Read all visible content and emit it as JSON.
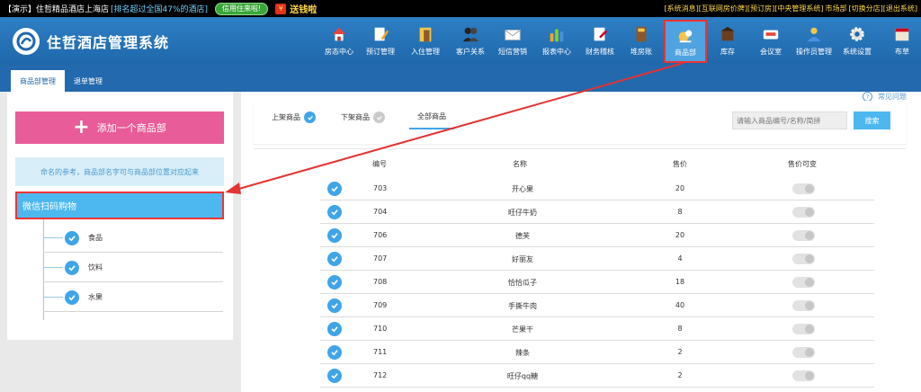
{
  "topbar": {
    "demo_text": "【演示】住哲精品酒店上海店",
    "rank_text": "[排名超过全国47%的酒店]",
    "credit_button": "信用住来啦!",
    "gift_icon": "gift-icon",
    "gift_text": "送钱啦",
    "links": [
      "[系统消息]",
      "[互联网房价牌]",
      "[预订房]",
      "[中央管理系统]",
      "市场部",
      "[切换分店]",
      "[退出系统]"
    ]
  },
  "header": {
    "brand": "住哲酒店管理系统",
    "nav": [
      {
        "label": "房态中心",
        "icon": "house-icon"
      },
      {
        "label": "预订管理",
        "icon": "booking-pen-icon"
      },
      {
        "label": "入住管理",
        "icon": "checkin-door-icon"
      },
      {
        "label": "客户关系",
        "icon": "customers-icon"
      },
      {
        "label": "短信营销",
        "icon": "sms-envelope-icon"
      },
      {
        "label": "报表中心",
        "icon": "report-chart-icon"
      },
      {
        "label": "财务稽核",
        "icon": "audit-icon"
      },
      {
        "label": "堆房账",
        "icon": "ledger-book-icon"
      },
      {
        "label": "商品部",
        "icon": "goods-bag-icon"
      },
      {
        "label": "库存",
        "icon": "inventory-icon"
      },
      {
        "label": "会议室",
        "icon": "meeting-room-icon"
      },
      {
        "label": "操作员管理",
        "icon": "operator-icon"
      },
      {
        "label": "系统设置",
        "icon": "settings-gear-icon"
      },
      {
        "label": "布草",
        "icon": "linen-icon"
      }
    ]
  },
  "subnav": {
    "tabs": [
      "商品部管理",
      "退单管理"
    ]
  },
  "sidebar": {
    "add_button": "添加一个商品部",
    "tip": "命名的参考，商品部名字可与商品部位置对应起来",
    "selected_group": "微信扫码购物",
    "subcategories": [
      "食品",
      "饮料",
      "水果"
    ]
  },
  "main": {
    "help": "常见问题",
    "filters": [
      "上架商品",
      "下架商品",
      "全部商品"
    ],
    "search_placeholder": "请输入商品编号/名称/简拼",
    "search_button": "搜索",
    "columns": [
      "编号",
      "名称",
      "售价",
      "售价可变"
    ],
    "rows": [
      {
        "id": "703",
        "name": "开心果",
        "price": "20"
      },
      {
        "id": "704",
        "name": "旺仔牛奶",
        "price": "8"
      },
      {
        "id": "706",
        "name": "德芙",
        "price": "20"
      },
      {
        "id": "707",
        "name": "好丽友",
        "price": "4"
      },
      {
        "id": "708",
        "name": "恰恰瓜子",
        "price": "18"
      },
      {
        "id": "709",
        "name": "手撕牛肉",
        "price": "40"
      },
      {
        "id": "710",
        "name": "芒果干",
        "price": "8"
      },
      {
        "id": "711",
        "name": "辣条",
        "price": "2"
      },
      {
        "id": "712",
        "name": "旺仔qq糖",
        "price": "2"
      }
    ]
  },
  "colors": {
    "header_blue": "#1f67ab",
    "accent_blue": "#4cb8ef",
    "pink": "#e85c99",
    "highlight_red": "#e33333"
  }
}
